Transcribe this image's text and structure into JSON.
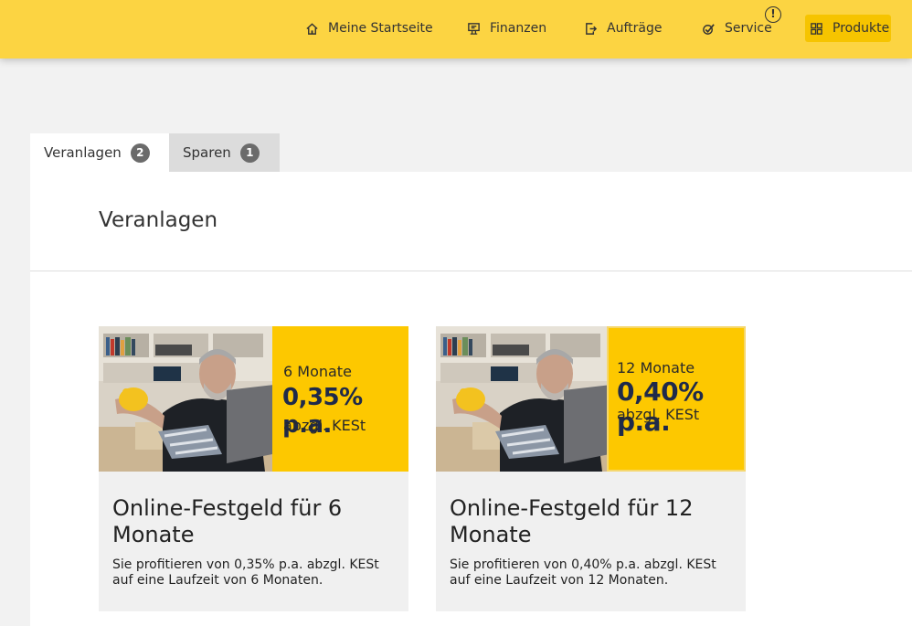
{
  "nav": {
    "items": [
      {
        "label": "Meine Startseite",
        "icon": "home-icon"
      },
      {
        "label": "Finanzen",
        "icon": "finance-icon"
      },
      {
        "label": "Aufträge",
        "icon": "orders-icon"
      },
      {
        "label": "Service",
        "icon": "service-check-icon"
      },
      {
        "label": "Produkte",
        "icon": "grid-icon"
      }
    ],
    "service_alert": "!",
    "active": "Produkte"
  },
  "tabs": [
    {
      "label": "Veranlagen",
      "count": "2"
    },
    {
      "label": "Sparen",
      "count": "1"
    }
  ],
  "panel": {
    "title": "Veranlagen"
  },
  "cards": [
    {
      "promo_term": "6 Monate",
      "promo_rate": "0,35% p.a.",
      "promo_note": "abzgl. KESt",
      "title": "Online-Festgeld für 6 Monate",
      "description": "Sie profitieren von 0,35% p.a. abzgl. KESt auf eine Laufzeit von 6 Monaten."
    },
    {
      "promo_term": "12 Monate",
      "promo_rate": "0,40% p.a.",
      "promo_note": "abzgl. KESt",
      "title": "Online-Festgeld für 12 Monate",
      "description": "Sie profitieren von 0,40% p.a. abzgl. KESt auf eine Laufzeit von 12 Monaten."
    }
  ],
  "colors": {
    "header": "#fcd442",
    "promo": "#fdc800",
    "active_nav": "#f6c400"
  }
}
